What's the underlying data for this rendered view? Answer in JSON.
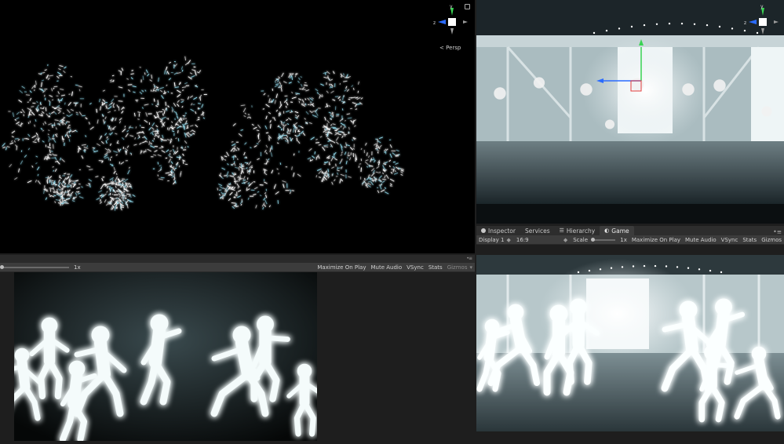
{
  "scene_view": {
    "camera_mode": "Persp",
    "gizmo_axes": {
      "y": "y",
      "z": "z"
    }
  },
  "top_right_view": {
    "gizmo_axes": {
      "y": "y",
      "z": "z"
    }
  },
  "bottom_left_view": {
    "scale_value": "1x",
    "toolbar": {
      "maximize_on_play": "Maximize On Play",
      "mute_audio": "Mute Audio",
      "vsync": "VSync",
      "stats": "Stats",
      "gizmos": "Gizmos"
    }
  },
  "game_panel": {
    "tabs": [
      {
        "label": "Inspector",
        "icon": "info-icon"
      },
      {
        "label": "Services",
        "icon": ""
      },
      {
        "label": "Hierarchy",
        "icon": "list-icon"
      },
      {
        "label": "Game",
        "icon": "gamepad-icon",
        "active": true
      }
    ],
    "toolbar": {
      "display": "Display 1",
      "aspect": "16:9",
      "scale_label": "Scale",
      "scale_value": "1x",
      "maximize_on_play": "Maximize On Play",
      "mute_audio": "Mute Audio",
      "vsync": "VSync",
      "stats": "Stats",
      "gizmos": "Gizmos"
    }
  },
  "colors": {
    "panel_bg": "#1e1e1e",
    "toolbar_bg": "#3c3c3c",
    "axis_y": "#39d353",
    "axis_z": "#2a6bff",
    "axis_x": "#e23c3c"
  }
}
